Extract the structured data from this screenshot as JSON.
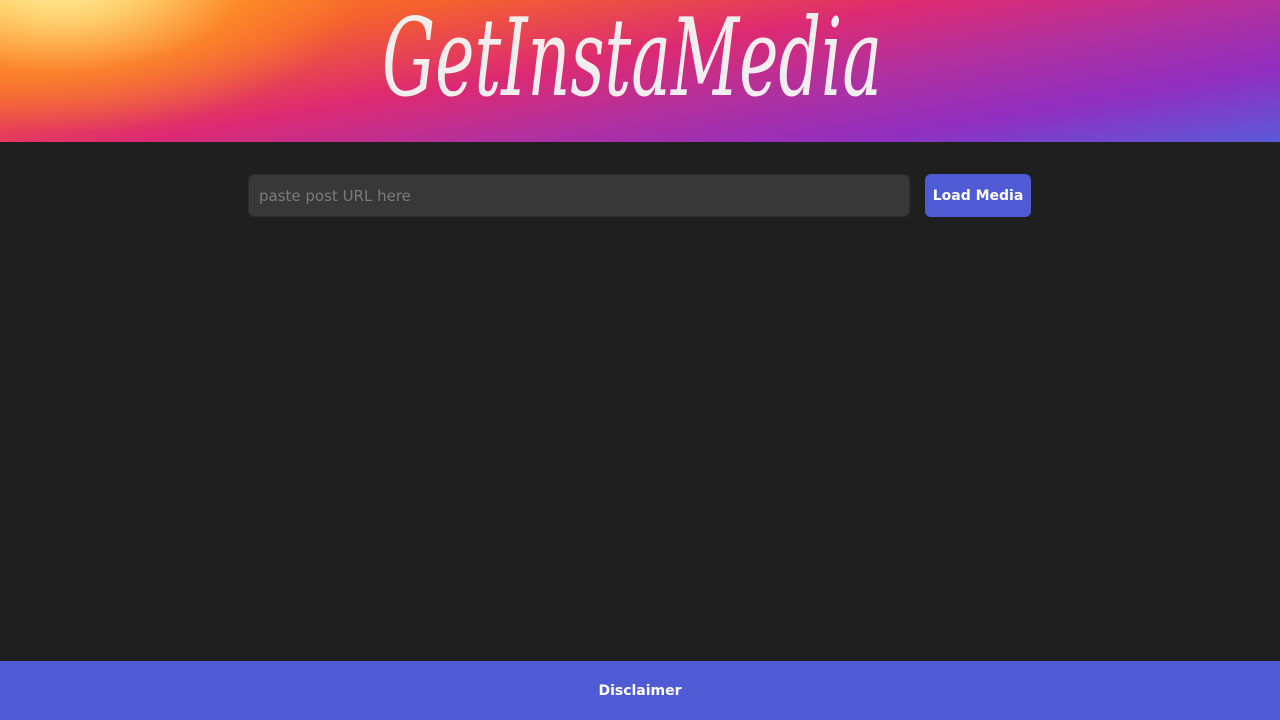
{
  "header": {
    "logo_text": "GetInstaMedia"
  },
  "search": {
    "placeholder": "paste post URL here",
    "value": "",
    "button_label": "Load Media"
  },
  "footer": {
    "disclaimer_label": "Disclaimer"
  },
  "colors": {
    "background": "#1f1f1f",
    "accent": "#4f5bd5",
    "input_background": "#383838",
    "logo_text": "#f3eeee"
  }
}
